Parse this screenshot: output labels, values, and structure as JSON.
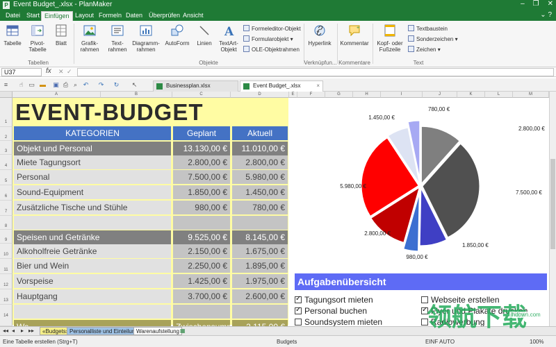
{
  "window": {
    "title": "Event Budget_.xlsx - PlanMaker",
    "app_letter": "P",
    "min": "–",
    "restore": "❐",
    "close": "✕"
  },
  "menu": {
    "tabs": [
      "Datei",
      "Start",
      "Einfügen",
      "Layout",
      "Formeln",
      "Daten",
      "Überprüfen",
      "Ansicht"
    ],
    "active": "Einfügen",
    "right": "⌄ ?"
  },
  "ribbon": {
    "buttons": {
      "tabelle": "Tabelle",
      "pivot": "Pivot-\nTabelle",
      "blatt": "Blatt",
      "grafik": "Grafik-\nrahmen",
      "text": "Text-\nrahmen",
      "diagramm": "Diagramm-\nrahmen",
      "autoform": "AutoForm",
      "linien": "Linien",
      "textart": "TextArt-\nObjekt",
      "hyperlink": "Hyperlink",
      "kommentar": "Kommentar",
      "kopf": "Kopf- oder\nFußzeile"
    },
    "small": {
      "formeleditor": "Formeleditor-Objekt",
      "formularobjekt": "Formularobjekt",
      "ole": "OLE-Objektrahmen",
      "textbaustein": "Textbaustein",
      "sonderzeichen": "Sonderzeichen",
      "zeichen": "Zeichen"
    },
    "groups": {
      "tabellen": "Tabellen",
      "objekte": "Objekte",
      "verknuepfungen": "Verknüpfun...",
      "kommentare": "Kommentare",
      "text": "Text"
    }
  },
  "formula": {
    "cell_ref": "U37",
    "fx": "fx",
    "value": ""
  },
  "doc_tabs": [
    {
      "label": "Businessplan.xlsx",
      "close": ""
    },
    {
      "label": "Event Budget_.xlsx",
      "close": "×"
    }
  ],
  "columns": [
    "A",
    "B",
    "C",
    "D",
    "E",
    "F",
    "G",
    "H",
    "I",
    "J",
    "K",
    "L",
    "M"
  ],
  "rows": [
    "1",
    "2",
    "3",
    "4",
    "5",
    "6",
    "7",
    "8",
    "9",
    "10",
    "11",
    "12",
    "13",
    "14"
  ],
  "budget": {
    "title": "EVENT-BUDGET",
    "headers": {
      "kategorien": "KATEGORIEN",
      "geplant": "Geplant",
      "aktuell": "Aktuell"
    },
    "rows": [
      {
        "name": "Objekt und Personal",
        "geplant": "13.130,00 €",
        "aktuell": "11.010,00 €"
      },
      {
        "name": "Miete Tagungsort",
        "geplant": "2.800,00 €",
        "aktuell": "2.800,00 €"
      },
      {
        "name": "Personal",
        "geplant": "7.500,00 €",
        "aktuell": "5.980,00 €"
      },
      {
        "name": "Sound-Equipment",
        "geplant": "1.850,00 €",
        "aktuell": "1.450,00 €"
      },
      {
        "name": "Zusätzliche Tische und Stühle",
        "geplant": "980,00 €",
        "aktuell": "780,00 €"
      },
      {
        "name": "",
        "geplant": "",
        "aktuell": ""
      },
      {
        "name": "Speisen und Getränke",
        "geplant": "9.525,00 €",
        "aktuell": "8.145,00 €"
      },
      {
        "name": "Alkoholfreie Getränke",
        "geplant": "2.150,00 €",
        "aktuell": "1.675,00 €"
      },
      {
        "name": "Bier und Wein",
        "geplant": "2.250,00 €",
        "aktuell": "1.895,00 €"
      },
      {
        "name": "Vorspeise",
        "geplant": "1.425,00 €",
        "aktuell": "1.975,00 €"
      },
      {
        "name": "Hauptgang",
        "geplant": "3.700,00 €",
        "aktuell": "2.600,00 €"
      },
      {
        "name": "",
        "geplant": "",
        "aktuell": ""
      },
      {
        "name": "Wa...",
        "geplant": "Zwischensumme",
        "aktuell": "2.115,00 €"
      }
    ]
  },
  "chart_data": {
    "type": "pie",
    "title": "",
    "categories": [
      "Miete Tagungsort",
      "Personal",
      "Sound-Equipment",
      "Zusätzliche Tische und Stühle",
      "Miete Tagungsort",
      "Personal",
      "Sound-Equipment",
      "Zusätzliche Tische und Stühle"
    ],
    "values": [
      2800,
      7500,
      1850,
      980,
      2800,
      5980,
      1450,
      780
    ],
    "labels": [
      "2.800,00 €",
      "7.500,00 €",
      "1.850,00 €",
      "980,00 €",
      "2.800,00 €",
      "5.980,00 €",
      "1.450,00 €",
      "780,00 €"
    ],
    "colors": [
      "#7f7f7f",
      "#505050",
      "#3f3fc4",
      "#3b6fd1",
      "#c00000",
      "#ff0000",
      "#dde3f3",
      "#a7a9f3"
    ]
  },
  "tasks": {
    "header": "Aufgabenübersicht",
    "left": [
      {
        "label": "Tagungsort mieten",
        "checked": true
      },
      {
        "label": "Personal buchen",
        "checked": true
      },
      {
        "label": "Soundsystem mieten",
        "checked": false
      }
    ],
    "right": [
      {
        "label": "Webseite erstellen",
        "checked": false
      },
      {
        "label": "Flyer und Plakate drucken",
        "checked": true
      },
      {
        "label": "Radiowerbung",
        "checked": false
      }
    ]
  },
  "sheet_tabs": [
    {
      "label": "«Budgets»",
      "bg": "#f6f08a"
    },
    {
      "label": "Personalliste und Einteilung",
      "bg": "#9ec2e6"
    },
    {
      "label": "Warenaufstellung",
      "bg": "#ffffff"
    }
  ],
  "nav": {
    "first": "◂◂",
    "prev": "◂",
    "next": "▸",
    "last": "▸▸"
  },
  "status": {
    "hint": "Eine Tabelle erstellen (Strg+T)",
    "sheet": "Budgets",
    "mode": "EINF AUTO",
    "zoom": "100%"
  },
  "watermark": {
    "main": "领航下载",
    "sub": "lhdown.com"
  }
}
